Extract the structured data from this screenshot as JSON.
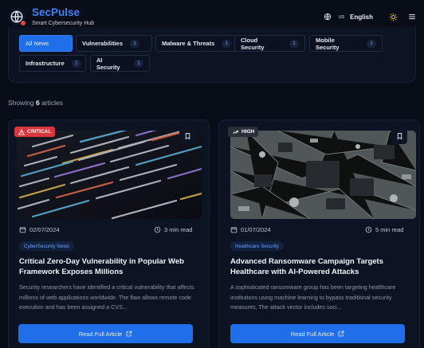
{
  "brand": {
    "title": "SecPulse",
    "subtitle": "Smart Cybersecurity Hub"
  },
  "header": {
    "lang_code": "us",
    "lang_name": "English"
  },
  "filters": [
    {
      "label": "All News",
      "active": true
    },
    {
      "label": "Vulnerabilities",
      "count": "1"
    },
    {
      "label": "Malware & Threats",
      "count": "1"
    },
    {
      "label": "Cloud Security",
      "count": "1"
    },
    {
      "label": "Mobile Security",
      "count": "1"
    },
    {
      "label": "Infrastructure",
      "count": "1"
    },
    {
      "label": "AI Security",
      "count": "1"
    }
  ],
  "showing": {
    "prefix": "Showing",
    "count": "6",
    "suffix": "articles"
  },
  "articles": [
    {
      "severity": "CRITICAL",
      "severity_color": "#d9363e",
      "date": "02/07/2024",
      "read_time": "3 min read",
      "category": "CyberSecurity News",
      "title": "Critical Zero-Day Vulnerability in Popular Web Framework Exposes Millions",
      "summary": "Security researchers have identified a critical vulnerability that affects millions of web applications worldwide. The flaw allows remote code execution and has been assigned a CVS...",
      "button": "Read Full Article",
      "image_icon": "code-screen-image"
    },
    {
      "severity": "HIGH",
      "severity_color": "#2a2f3a",
      "date": "01/07/2024",
      "read_time": "5 min read",
      "category": "Healthcare Security",
      "title": "Advanced Ransomware Campaign Targets Healthcare with AI-Powered Attacks",
      "summary": "A sophisticated ransomware group has been targeting healthcare institutions using machine learning to bypass traditional security measures. The attack vector includes soci...",
      "button": "Read Full Article",
      "image_icon": "circuit-board-image"
    }
  ],
  "colors": {
    "accent": "#1f6feb",
    "brand": "#3b82f6",
    "background": "#080d17",
    "card": "#0c1322"
  }
}
